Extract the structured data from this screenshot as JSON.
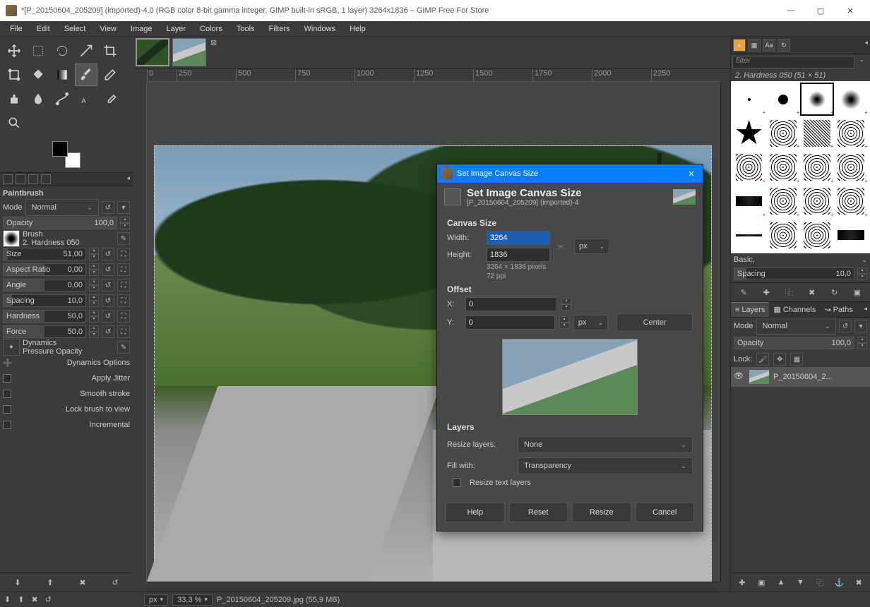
{
  "title": "*[P_20150604_205209] (imported)-4.0 (RGB color 8-bit gamma integer, GIMP built-in sRGB, 1 layer) 3264x1836 – GIMP Free For Store",
  "menu": [
    "File",
    "Edit",
    "Select",
    "View",
    "Image",
    "Layer",
    "Colors",
    "Tools",
    "Filters",
    "Windows",
    "Help"
  ],
  "toolbox_active_tool": "Paintbrush",
  "tool_options": {
    "tool_name": "Paintbrush",
    "mode_label": "Mode",
    "mode_value": "Normal",
    "opacity_label": "Opacity",
    "opacity_value": "100,0",
    "brush_section": "Brush",
    "brush_name": "2. Hardness 050",
    "size_label": "Size",
    "size_value": "51,00",
    "aspect_label": "Aspect Ratio",
    "aspect_value": "0,00",
    "angle_label": "Angle",
    "angle_value": "0,00",
    "spacing_label": "Spacing",
    "spacing_value": "10,0",
    "hardness_label": "Hardness",
    "hardness_value": "50,0",
    "force_label": "Force",
    "force_value": "50,0",
    "dynamics_label": "Dynamics",
    "dynamics_value": "Pressure Opacity",
    "dyn_options": "Dynamics Options",
    "apply_jitter": "Apply Jitter",
    "smooth_stroke": "Smooth stroke",
    "lock_brush": "Lock brush to view",
    "incremental": "Incremental"
  },
  "ruler_marks": [
    "0",
    "250",
    "500",
    "750",
    "1000",
    "1250",
    "1500",
    "1750",
    "2000",
    "2250"
  ],
  "dialog": {
    "window_title": "Set Image Canvas Size",
    "heading": "Set Image Canvas Size",
    "subtitle": "[P_20150604_205209] (imported)-4",
    "canvas_size": "Canvas Size",
    "width_label": "Width:",
    "width_value": "3264",
    "height_label": "Height:",
    "height_value": "1836",
    "unit": "px",
    "dim_text": "3264 × 1836 pixels",
    "ppi_text": "72 ppi",
    "offset": "Offset",
    "x_label": "X:",
    "x_value": "0",
    "y_label": "Y:",
    "y_value": "0",
    "center": "Center",
    "layers": "Layers",
    "resize_layers_label": "Resize layers:",
    "resize_layers_value": "None",
    "fill_with_label": "Fill with:",
    "fill_with_value": "Transparency",
    "resize_text": "Resize text layers",
    "btn_help": "Help",
    "btn_reset": "Reset",
    "btn_resize": "Resize",
    "btn_cancel": "Cancel"
  },
  "right": {
    "filter_placeholder": "filter",
    "brush_title": "2. Hardness 050 (51 × 51)",
    "basic": "Basic,",
    "spacing_label": "Spacing",
    "spacing_value": "10,0",
    "layers_tab": "Layers",
    "channels_tab": "Channels",
    "paths_tab": "Paths",
    "mode_label": "Mode",
    "mode_value": "Normal",
    "opacity_label": "Opacity",
    "opacity_value": "100,0",
    "lock_label": "Lock:",
    "layer_name": "P_20150604_2..."
  },
  "status": {
    "unit": "px",
    "zoom": "33,3 %",
    "file_info": "P_20150604_205209.jpg (55,9 MB)"
  }
}
